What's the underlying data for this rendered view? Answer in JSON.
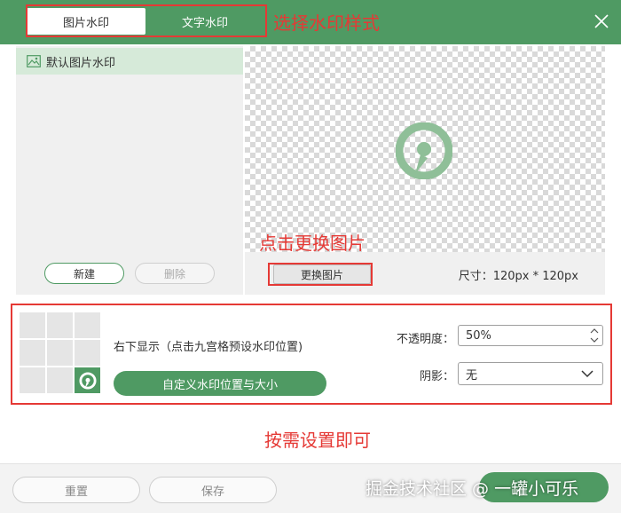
{
  "tabs": [
    {
      "label": "图片水印",
      "active": true
    },
    {
      "label": "文字水印",
      "active": false
    }
  ],
  "annotations": {
    "choose_style": "选择水印样式",
    "change_image": "点击更换图片",
    "set_as_needed": "按需设置即可"
  },
  "list": {
    "items": [
      {
        "label": "默认图片水印",
        "icon": "image-icon"
      }
    ],
    "new_label": "新建",
    "delete_label": "删除"
  },
  "preview": {
    "change_button": "更换图片",
    "size_text": "尺寸：120px * 120px"
  },
  "settings": {
    "position_text": "右下显示（点击九宫格预设水印位置)",
    "selected_cell": 8,
    "custom_button": "自定义水印位置与大小",
    "opacity_label": "不透明度：",
    "opacity_value": "50%",
    "shadow_label": "阴影：",
    "shadow_value": "无"
  },
  "footer": {
    "reset_label": "重置",
    "save_label": "保存"
  },
  "site_watermark": "掘金技术社区 @ 一罐小可乐",
  "colors": {
    "brand_green": "#4f9a63",
    "annotation_red": "#e53935"
  }
}
